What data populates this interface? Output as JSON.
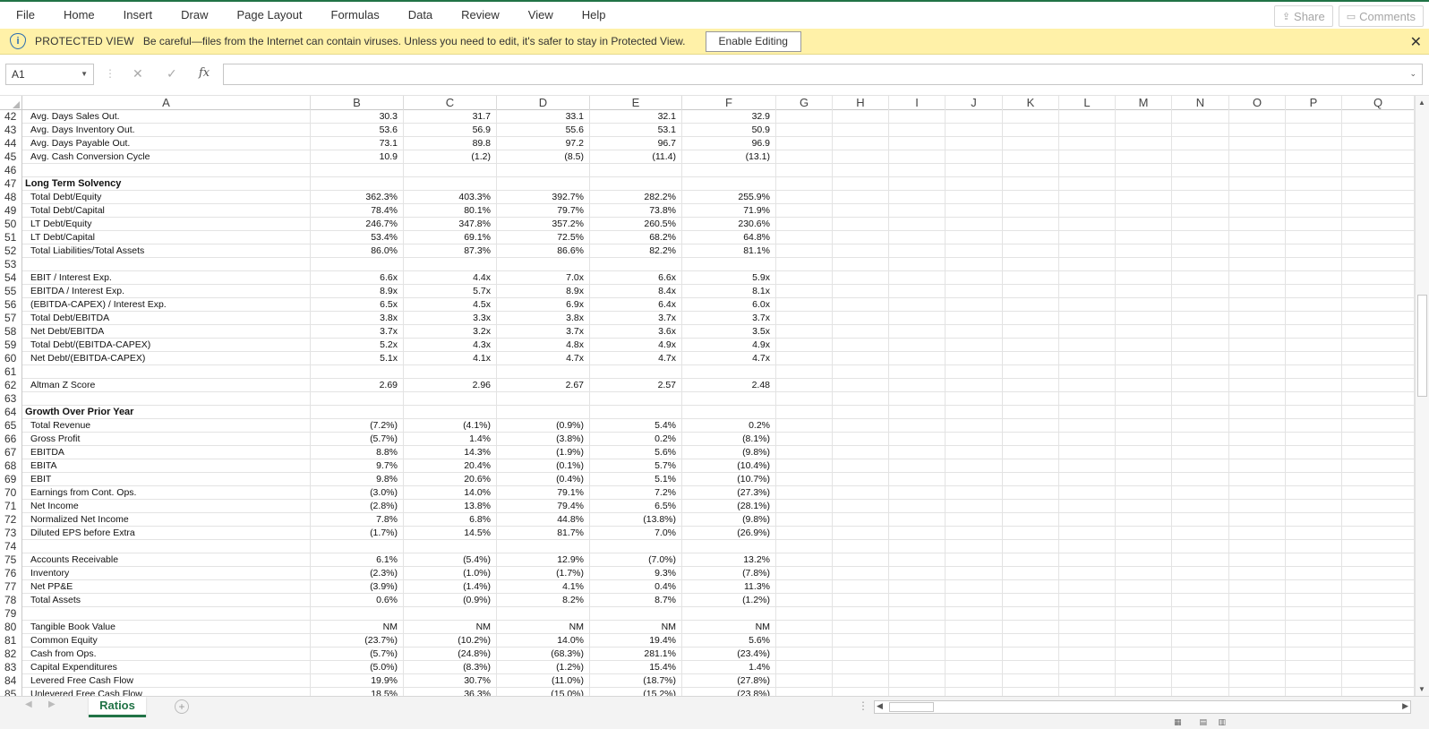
{
  "ribbon": {
    "tabs": [
      "File",
      "Home",
      "Insert",
      "Draw",
      "Page Layout",
      "Formulas",
      "Data",
      "Review",
      "View",
      "Help"
    ],
    "share_label": "Share",
    "comments_label": "Comments"
  },
  "protected_view": {
    "title": "PROTECTED VIEW",
    "message": "Be careful—files from the Internet can contain viruses. Unless you need to edit, it's safer to stay in Protected View.",
    "enable_label": "Enable Editing",
    "close_glyph": "✕"
  },
  "formula_bar": {
    "name_box": "A1",
    "formula": ""
  },
  "columns": [
    "A",
    "B",
    "C",
    "D",
    "E",
    "F",
    "G",
    "H",
    "I",
    "J",
    "K",
    "L",
    "M",
    "N",
    "O",
    "P",
    "Q"
  ],
  "rows": [
    {
      "n": "42",
      "label": "Avg. Days Sales Out.",
      "bold": false,
      "v": [
        "30.3",
        "31.7",
        "33.1",
        "32.1",
        "32.9"
      ]
    },
    {
      "n": "43",
      "label": "Avg. Days Inventory Out.",
      "bold": false,
      "v": [
        "53.6",
        "56.9",
        "55.6",
        "53.1",
        "50.9"
      ]
    },
    {
      "n": "44",
      "label": "Avg. Days Payable Out.",
      "bold": false,
      "v": [
        "73.1",
        "89.8",
        "97.2",
        "96.7",
        "96.9"
      ]
    },
    {
      "n": "45",
      "label": "Avg. Cash Conversion Cycle",
      "bold": false,
      "v": [
        "10.9",
        "(1.2)",
        "(8.5)",
        "(11.4)",
        "(13.1)"
      ]
    },
    {
      "n": "46",
      "label": "",
      "bold": false,
      "v": [
        "",
        "",
        "",
        "",
        ""
      ]
    },
    {
      "n": "47",
      "label": "Long Term Solvency",
      "bold": true,
      "v": [
        "",
        "",
        "",
        "",
        ""
      ]
    },
    {
      "n": "48",
      "label": "Total Debt/Equity",
      "bold": false,
      "v": [
        "362.3%",
        "403.3%",
        "392.7%",
        "282.2%",
        "255.9%"
      ]
    },
    {
      "n": "49",
      "label": "Total Debt/Capital",
      "bold": false,
      "v": [
        "78.4%",
        "80.1%",
        "79.7%",
        "73.8%",
        "71.9%"
      ]
    },
    {
      "n": "50",
      "label": "LT Debt/Equity",
      "bold": false,
      "v": [
        "246.7%",
        "347.8%",
        "357.2%",
        "260.5%",
        "230.6%"
      ]
    },
    {
      "n": "51",
      "label": "LT Debt/Capital",
      "bold": false,
      "v": [
        "53.4%",
        "69.1%",
        "72.5%",
        "68.2%",
        "64.8%"
      ]
    },
    {
      "n": "52",
      "label": "Total Liabilities/Total Assets",
      "bold": false,
      "v": [
        "86.0%",
        "87.3%",
        "86.6%",
        "82.2%",
        "81.1%"
      ]
    },
    {
      "n": "53",
      "label": "",
      "bold": false,
      "v": [
        "",
        "",
        "",
        "",
        ""
      ]
    },
    {
      "n": "54",
      "label": "EBIT / Interest Exp.",
      "bold": false,
      "v": [
        "6.6x",
        "4.4x",
        "7.0x",
        "6.6x",
        "5.9x"
      ]
    },
    {
      "n": "55",
      "label": "EBITDA / Interest Exp.",
      "bold": false,
      "v": [
        "8.9x",
        "5.7x",
        "8.9x",
        "8.4x",
        "8.1x"
      ]
    },
    {
      "n": "56",
      "label": "(EBITDA-CAPEX) / Interest Exp.",
      "bold": false,
      "v": [
        "6.5x",
        "4.5x",
        "6.9x",
        "6.4x",
        "6.0x"
      ]
    },
    {
      "n": "57",
      "label": "Total Debt/EBITDA",
      "bold": false,
      "v": [
        "3.8x",
        "3.3x",
        "3.8x",
        "3.7x",
        "3.7x"
      ]
    },
    {
      "n": "58",
      "label": "Net Debt/EBITDA",
      "bold": false,
      "v": [
        "3.7x",
        "3.2x",
        "3.7x",
        "3.6x",
        "3.5x"
      ]
    },
    {
      "n": "59",
      "label": "Total Debt/(EBITDA-CAPEX)",
      "bold": false,
      "v": [
        "5.2x",
        "4.3x",
        "4.8x",
        "4.9x",
        "4.9x"
      ]
    },
    {
      "n": "60",
      "label": "Net Debt/(EBITDA-CAPEX)",
      "bold": false,
      "v": [
        "5.1x",
        "4.1x",
        "4.7x",
        "4.7x",
        "4.7x"
      ]
    },
    {
      "n": "61",
      "label": "",
      "bold": false,
      "v": [
        "",
        "",
        "",
        "",
        ""
      ]
    },
    {
      "n": "62",
      "label": "Altman Z Score",
      "bold": false,
      "v": [
        "2.69",
        "2.96",
        "2.67",
        "2.57",
        "2.48"
      ]
    },
    {
      "n": "63",
      "label": "",
      "bold": false,
      "v": [
        "",
        "",
        "",
        "",
        ""
      ]
    },
    {
      "n": "64",
      "label": "Growth Over Prior Year",
      "bold": true,
      "v": [
        "",
        "",
        "",
        "",
        ""
      ]
    },
    {
      "n": "65",
      "label": "Total Revenue",
      "bold": false,
      "v": [
        "(7.2%)",
        "(4.1%)",
        "(0.9%)",
        "5.4%",
        "0.2%"
      ]
    },
    {
      "n": "66",
      "label": "Gross Profit",
      "bold": false,
      "v": [
        "(5.7%)",
        "1.4%",
        "(3.8%)",
        "0.2%",
        "(8.1%)"
      ]
    },
    {
      "n": "67",
      "label": "EBITDA",
      "bold": false,
      "v": [
        "8.8%",
        "14.3%",
        "(1.9%)",
        "5.6%",
        "(9.8%)"
      ]
    },
    {
      "n": "68",
      "label": "EBITA",
      "bold": false,
      "v": [
        "9.7%",
        "20.4%",
        "(0.1%)",
        "5.7%",
        "(10.4%)"
      ]
    },
    {
      "n": "69",
      "label": "EBIT",
      "bold": false,
      "v": [
        "9.8%",
        "20.6%",
        "(0.4%)",
        "5.1%",
        "(10.7%)"
      ]
    },
    {
      "n": "70",
      "label": "Earnings from Cont. Ops.",
      "bold": false,
      "v": [
        "(3.0%)",
        "14.0%",
        "79.1%",
        "7.2%",
        "(27.3%)"
      ]
    },
    {
      "n": "71",
      "label": "Net Income",
      "bold": false,
      "v": [
        "(2.8%)",
        "13.8%",
        "79.4%",
        "6.5%",
        "(28.1%)"
      ]
    },
    {
      "n": "72",
      "label": "Normalized Net Income",
      "bold": false,
      "v": [
        "7.8%",
        "6.8%",
        "44.8%",
        "(13.8%)",
        "(9.8%)"
      ]
    },
    {
      "n": "73",
      "label": "Diluted EPS before Extra",
      "bold": false,
      "v": [
        "(1.7%)",
        "14.5%",
        "81.7%",
        "7.0%",
        "(26.9%)"
      ]
    },
    {
      "n": "74",
      "label": "",
      "bold": false,
      "v": [
        "",
        "",
        "",
        "",
        ""
      ]
    },
    {
      "n": "75",
      "label": "Accounts Receivable",
      "bold": false,
      "v": [
        "6.1%",
        "(5.4%)",
        "12.9%",
        "(7.0%)",
        "13.2%"
      ]
    },
    {
      "n": "76",
      "label": "Inventory",
      "bold": false,
      "v": [
        "(2.3%)",
        "(1.0%)",
        "(1.7%)",
        "9.3%",
        "(7.8%)"
      ]
    },
    {
      "n": "77",
      "label": "Net PP&E",
      "bold": false,
      "v": [
        "(3.9%)",
        "(1.4%)",
        "4.1%",
        "0.4%",
        "11.3%"
      ]
    },
    {
      "n": "78",
      "label": "Total Assets",
      "bold": false,
      "v": [
        "0.6%",
        "(0.9%)",
        "8.2%",
        "8.7%",
        "(1.2%)"
      ]
    },
    {
      "n": "79",
      "label": "",
      "bold": false,
      "v": [
        "",
        "",
        "",
        "",
        ""
      ]
    },
    {
      "n": "80",
      "label": "Tangible Book Value",
      "bold": false,
      "v": [
        "NM",
        "NM",
        "NM",
        "NM",
        "NM"
      ]
    },
    {
      "n": "81",
      "label": "Common Equity",
      "bold": false,
      "v": [
        "(23.7%)",
        "(10.2%)",
        "14.0%",
        "19.4%",
        "5.6%"
      ]
    },
    {
      "n": "82",
      "label": "Cash from Ops.",
      "bold": false,
      "v": [
        "(5.7%)",
        "(24.8%)",
        "(68.3%)",
        "281.1%",
        "(23.4%)"
      ]
    },
    {
      "n": "83",
      "label": "Capital Expenditures",
      "bold": false,
      "v": [
        "(5.0%)",
        "(8.3%)",
        "(1.2%)",
        "15.4%",
        "1.4%"
      ]
    },
    {
      "n": "84",
      "label": "Levered Free Cash Flow",
      "bold": false,
      "v": [
        "19.9%",
        "30.7%",
        "(11.0%)",
        "(18.7%)",
        "(27.8%)"
      ]
    },
    {
      "n": "85",
      "label": "Unlevered Free Cash Flow",
      "bold": false,
      "v": [
        "18.5%",
        "36.3%",
        "(15.0%)",
        "(15.2%)",
        "(23.8%)"
      ]
    }
  ],
  "sheet_tabs": [
    "Ratios"
  ],
  "status": {
    "ready_label": ""
  }
}
